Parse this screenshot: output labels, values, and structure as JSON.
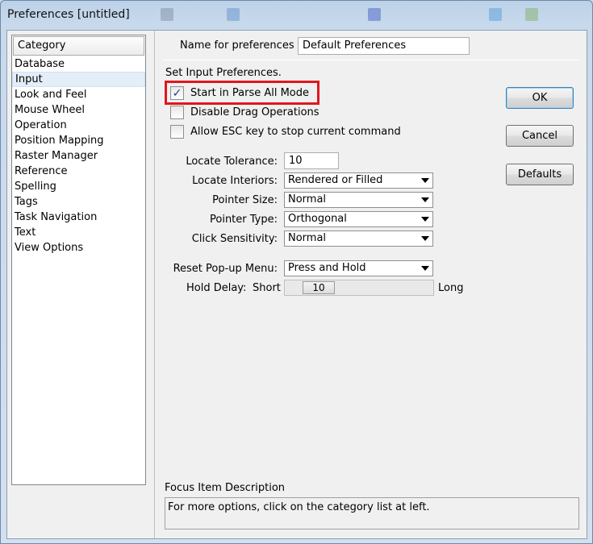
{
  "window": {
    "title": "Preferences [untitled]"
  },
  "category": {
    "header": "Category",
    "items": [
      {
        "label": "Database"
      },
      {
        "label": "Input"
      },
      {
        "label": "Look and Feel"
      },
      {
        "label": "Mouse Wheel"
      },
      {
        "label": "Operation"
      },
      {
        "label": "Position Mapping"
      },
      {
        "label": "Raster Manager"
      },
      {
        "label": "Reference"
      },
      {
        "label": "Spelling"
      },
      {
        "label": "Tags"
      },
      {
        "label": "Task Navigation"
      },
      {
        "label": "Text"
      },
      {
        "label": "View Options"
      }
    ],
    "selected": "Input"
  },
  "prefs_name": {
    "label": "Name for preferences",
    "value": "Default Preferences"
  },
  "section_title": "Set Input Preferences.",
  "checkboxes": {
    "parse_all": {
      "label": "Start in Parse All Mode",
      "checked": true
    },
    "disable_drag": {
      "label": "Disable Drag Operations",
      "checked": false
    },
    "allow_esc": {
      "label": "Allow ESC key to stop current command",
      "checked": false
    }
  },
  "buttons": {
    "ok": "OK",
    "cancel": "Cancel",
    "defaults": "Defaults"
  },
  "locate_tolerance": {
    "label": "Locate Tolerance:",
    "value": "10"
  },
  "locate_interiors": {
    "label": "Locate Interiors:",
    "value": "Rendered or Filled"
  },
  "pointer_size": {
    "label": "Pointer Size:",
    "value": "Normal"
  },
  "pointer_type": {
    "label": "Pointer Type:",
    "value": "Orthogonal"
  },
  "click_sensitivity": {
    "label": "Click Sensitivity:",
    "value": "Normal"
  },
  "reset_popup": {
    "label": "Reset Pop-up Menu:",
    "value": "Press and Hold"
  },
  "hold_delay": {
    "label": "Hold Delay:",
    "min_label": "Short",
    "value": "10",
    "max_label": "Long"
  },
  "focus": {
    "title": "Focus Item Description",
    "text": "For more options, click on the category list at left."
  },
  "colors": {
    "highlight": "#e0161f",
    "selected_bg": "#e3eef9"
  }
}
